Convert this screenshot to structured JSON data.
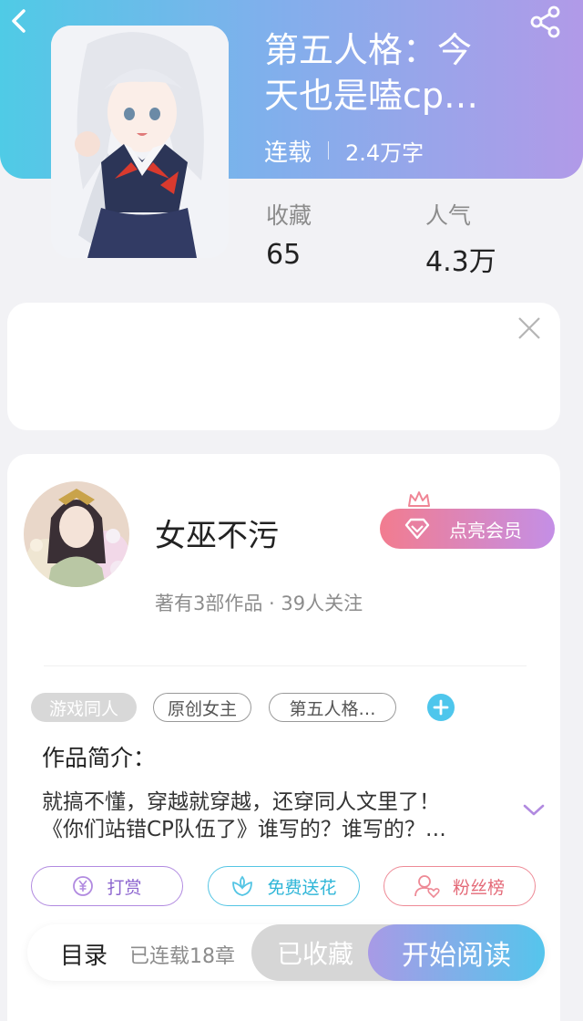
{
  "header": {
    "title_line1": "第五人格：今",
    "title_line2": "天也是嗑cp…",
    "status": "连载",
    "word_count": "2.4万字",
    "back_icon": "chevron-left-icon",
    "share_icon": "share-icon"
  },
  "stats": {
    "favorites_label": "收藏",
    "favorites_value": "65",
    "popularity_label": "人气",
    "popularity_value": "4.3万"
  },
  "author": {
    "name": "女巫不污",
    "vip_button": "点亮会员",
    "stats": "著有3部作品 · 39人关注"
  },
  "tags": [
    "游戏同人",
    "原创女主",
    "第五人格…"
  ],
  "intro": {
    "title": "作品简介：",
    "line1": "就搞不懂，穿越就穿越，还穿同人文里了！",
    "line2": "《你们站错CP队伍了》谁写的？谁写的？…"
  },
  "actions": {
    "tip": "打赏",
    "flower": "免费送花",
    "fans": "粉丝榜"
  },
  "bottom_bar": {
    "toc": "目录",
    "chapters": "已连载18章",
    "collected": "已收藏",
    "read": "开始阅读"
  },
  "colors": {
    "header_gradient_start": "#4fcbe6",
    "header_gradient_end": "#b19ae8",
    "vip_gradient_start": "#f27c8f",
    "vip_gradient_end": "#c48fe6",
    "read_gradient_start": "#a89ae6",
    "read_gradient_end": "#55c5ec"
  }
}
